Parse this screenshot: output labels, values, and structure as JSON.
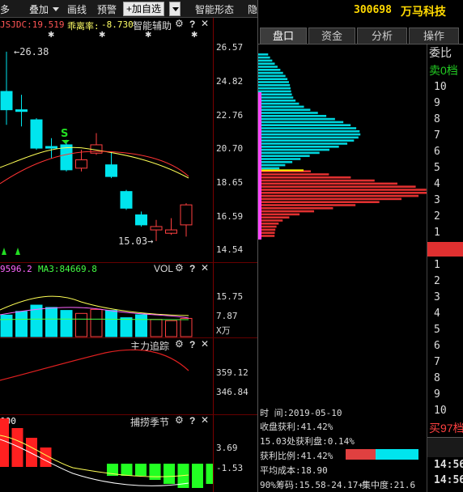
{
  "toolbar": {
    "items": [
      "多",
      "叠加",
      "画线",
      "预警"
    ],
    "add_button": "+加自选",
    "smart_form": "智能形态",
    "hidden": "隐"
  },
  "main_chart": {
    "indicator_1": "JSJDC:19.519",
    "indicator_2_label": "乖离率:",
    "indicator_2_value": "-8.730",
    "assist": "智能辅助",
    "high_label": "26.38",
    "low_label": "15.03",
    "signal_mark": "S",
    "y_ticks": [
      "26.57",
      "24.82",
      "22.76",
      "20.70",
      "18.65",
      "16.59",
      "14.54"
    ]
  },
  "vol_panel": {
    "ma_left": "9596.2",
    "ma3": "MA3:84669.8",
    "name": "VOL",
    "y_ticks": [
      "15.75",
      "7.87",
      "X万"
    ]
  },
  "main_force": {
    "name": "主力追踪",
    "y_ticks": [
      "359.12",
      "346.84"
    ]
  },
  "season": {
    "left": "000",
    "name": "捕捞季节",
    "y_ticks": [
      "3.69",
      "-1.53"
    ]
  },
  "candles": [
    {
      "o": 24.0,
      "c": 22.9,
      "h": 26.38,
      "l": 22.0
    },
    {
      "o": 22.9,
      "c": 22.8,
      "h": 23.8,
      "l": 21.9
    },
    {
      "o": 22.3,
      "c": 20.6,
      "h": 22.4,
      "l": 20.5
    },
    {
      "o": 20.7,
      "c": 20.6,
      "h": 21.2,
      "l": 20.0
    },
    {
      "o": 20.8,
      "c": 19.3,
      "h": 21.1,
      "l": 19.2
    },
    {
      "o": 19.4,
      "c": 19.9,
      "h": 20.5,
      "l": 19.2
    },
    {
      "o": 20.3,
      "c": 20.8,
      "h": 21.5,
      "l": 20.2
    },
    {
      "o": 19.6,
      "c": 18.9,
      "h": 20.4,
      "l": 18.8
    },
    {
      "o": 18.0,
      "c": 17.0,
      "h": 18.1,
      "l": 16.9
    },
    {
      "o": 16.6,
      "c": 16.0,
      "h": 16.8,
      "l": 15.9
    },
    {
      "o": 15.7,
      "c": 15.9,
      "h": 16.3,
      "l": 15.03
    },
    {
      "o": 15.5,
      "c": 15.7,
      "h": 16.4,
      "l": 15.4
    },
    {
      "o": 16.0,
      "c": 17.2,
      "h": 17.3,
      "l": 15.3
    }
  ],
  "right": {
    "code": "300698",
    "name": "万马科技",
    "tabs": [
      "盘口",
      "资金",
      "分析",
      "操作"
    ],
    "ladder_head": "委比",
    "sell_label": "卖0档",
    "sell_levels": [
      "10",
      "9",
      "8",
      "7",
      "6",
      "5",
      "4",
      "3",
      "2",
      "1"
    ],
    "buy_levels": [
      "1",
      "2",
      "3",
      "4",
      "5",
      "6",
      "7",
      "8",
      "9",
      "10"
    ],
    "buy_label": "买97档",
    "time_1": "14:56",
    "time_2": "14:56"
  },
  "stats": {
    "time_label": "时        间:2019-05-10",
    "close_profit": "收盘获利:41.42%",
    "at_price": "15.03处获利盘:0.14%",
    "profit_ratio": "获利比例:41.42%",
    "avg_cost": "平均成本:18.90",
    "chip_90": "90%筹码:15.58-24.17+",
    "concentration": "集中度:21.6",
    "profit_fraction": 0.41
  }
}
